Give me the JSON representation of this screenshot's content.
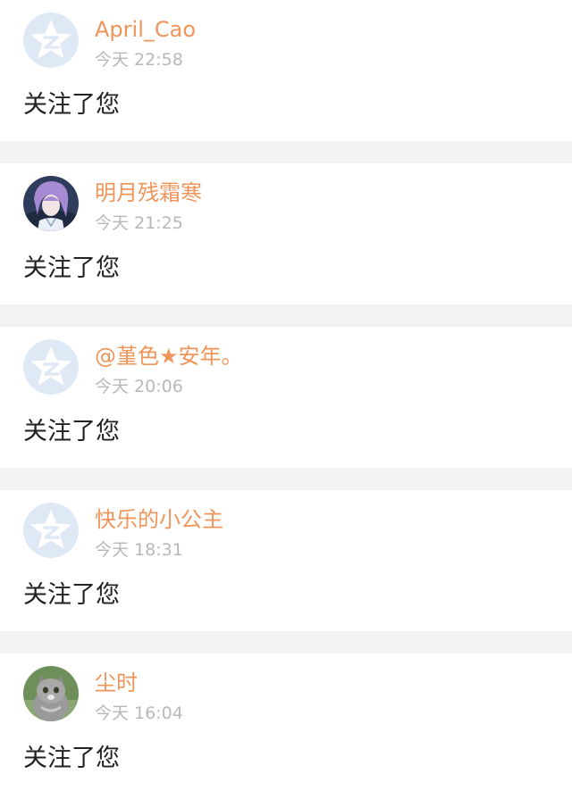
{
  "colors": {
    "username": "#f0955a",
    "time": "#b8b8b8",
    "message": "#222222",
    "separator": "#f3f3f3",
    "default_avatar_bg": "#dfe8f5"
  },
  "notifications": [
    {
      "username": "April_Cao",
      "time": "今天 22:58",
      "message": "关注了您",
      "avatar": "default-avatar-icon"
    },
    {
      "username": "明月残霜寒",
      "time": "今天 21:25",
      "message": "关注了您",
      "avatar": "anime-character-avatar"
    },
    {
      "username": "@堇色★安年。",
      "time": "今天 20:06",
      "message": "关注了您",
      "avatar": "default-avatar-icon"
    },
    {
      "username": "快乐的小公主",
      "time": "今天 18:31",
      "message": "关注了您",
      "avatar": "default-avatar-icon"
    },
    {
      "username": "尘时",
      "time": "今天 16:04",
      "message": "关注了您",
      "avatar": "cat-photo-avatar"
    }
  ]
}
